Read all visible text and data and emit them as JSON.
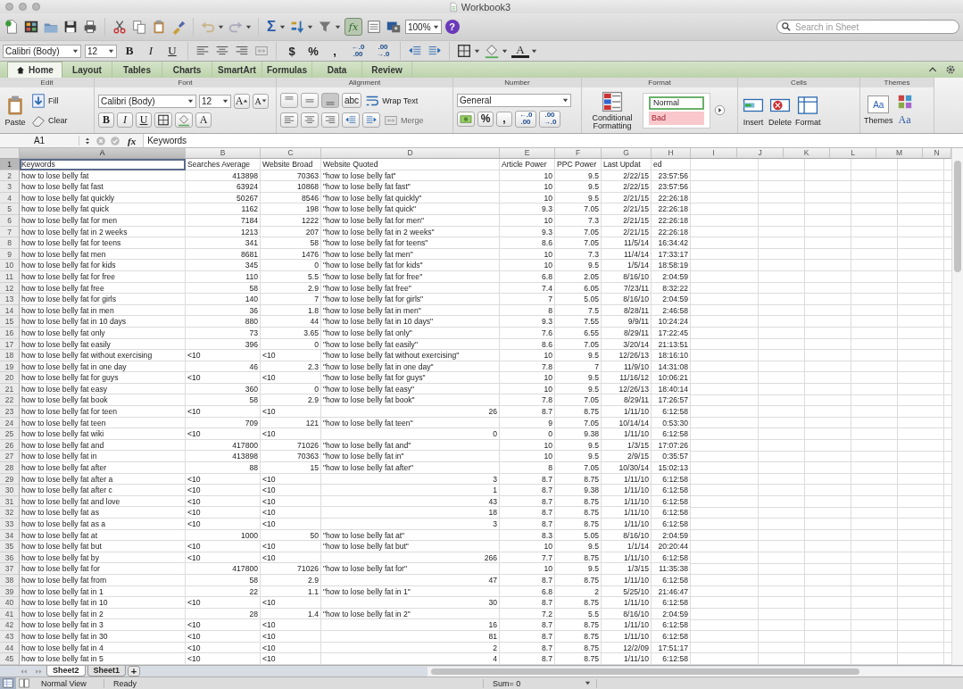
{
  "window": {
    "title": "Workbook3"
  },
  "toolbar": {
    "sum": "Σ",
    "fx": {
      "label": "fx",
      "selected": true
    },
    "zoom": "100%",
    "help": "?",
    "search": {
      "placeholder": "Search in Sheet"
    }
  },
  "format_bar": {
    "font": "Calibri (Body)",
    "size": "12",
    "styles": [
      "B",
      "I",
      "U"
    ],
    "number_buttons": [
      "$",
      "%",
      ","
    ],
    "decimals": [
      {
        "top": "←.0",
        "bottom": ".00"
      },
      {
        "top": ".00",
        "bottom": "→.0"
      }
    ],
    "font_color": "A"
  },
  "ribbon": {
    "tabs": [
      {
        "label": "Home",
        "selected": true
      },
      {
        "label": "Layout",
        "selected": false
      },
      {
        "label": "Tables",
        "selected": false
      },
      {
        "label": "Charts",
        "selected": false
      },
      {
        "label": "SmartArt",
        "selected": false
      },
      {
        "label": "Formulas",
        "selected": false
      },
      {
        "label": "Data",
        "selected": false
      },
      {
        "label": "Review",
        "selected": false
      }
    ],
    "edit": {
      "title": "Edit",
      "paste": "Paste",
      "fill": "Fill",
      "clear": "Clear"
    },
    "font": {
      "title": "Font",
      "family": "Calibri (Body)",
      "size": "12",
      "grow": "A",
      "shrink": "A",
      "styles": [
        "B",
        "I",
        "U"
      ],
      "color_button": "A"
    },
    "alignment": {
      "title": "Alignment",
      "orientation": "abc",
      "wrap": "Wrap Text",
      "merge": {
        "label": "Merge",
        "disabled": true
      }
    },
    "number": {
      "title": "Number",
      "format": "General",
      "buttons": [
        "%",
        ","
      ],
      "decimals": [
        {
          "top": "←.0",
          "bottom": ".00"
        },
        {
          "top": ".00",
          "bottom": "→.0"
        }
      ]
    },
    "format": {
      "title": "Format",
      "conditional": "Conditional Formatting",
      "styles": [
        {
          "label": "Normal",
          "kind": "normal"
        },
        {
          "label": "Bad",
          "kind": "bad"
        }
      ]
    },
    "cells": {
      "title": "Cells",
      "buttons": [
        "Insert",
        "Delete",
        "Format"
      ]
    },
    "themes": {
      "title": "Themes",
      "icon_text": "Aa",
      "label": "Themes",
      "fonts": "Aa"
    }
  },
  "formula_bar": {
    "cell": "A1",
    "fx": "fx",
    "value": "Keywords"
  },
  "sheet": {
    "columns": [
      {
        "label": "A",
        "selected": true
      },
      {
        "label": "B",
        "selected": false
      },
      {
        "label": "C",
        "selected": false
      },
      {
        "label": "D",
        "selected": false
      },
      {
        "label": "E",
        "selected": false
      },
      {
        "label": "F",
        "selected": false
      },
      {
        "label": "G",
        "selected": false
      },
      {
        "label": "H",
        "selected": false
      },
      {
        "label": "I",
        "selected": false
      },
      {
        "label": "J",
        "selected": false
      },
      {
        "label": "K",
        "selected": false
      },
      {
        "label": "L",
        "selected": false
      },
      {
        "label": "M",
        "selected": false
      },
      {
        "label": "N",
        "selected": false
      }
    ],
    "rows": [
      {
        "n": "1",
        "selected": true,
        "cells": [
          {
            "text": "Keywords",
            "kind": "text"
          },
          {
            "text": "Searches Average",
            "kind": "text"
          },
          {
            "text": "Website Broad",
            "kind": "text"
          },
          {
            "text": "Website Quoted",
            "kind": "text"
          },
          {
            "text": "Article Power",
            "kind": "text"
          },
          {
            "text": "PPC Power",
            "kind": "text"
          },
          {
            "text": "Last Updat",
            "kind": "text"
          },
          {
            "text": "ed",
            "kind": "text"
          }
        ]
      },
      {
        "n": "2",
        "selected": false,
        "cells": [
          {
            "text": "how to lose belly fat",
            "kind": "text"
          },
          {
            "text": "413898",
            "kind": "number"
          },
          {
            "text": "70363",
            "kind": "number"
          },
          {
            "text": "\"how to lose belly fat\"",
            "kind": "text"
          },
          {
            "text": "10",
            "kind": "number"
          },
          {
            "text": "9.5",
            "kind": "number"
          },
          {
            "text": "2/22/15",
            "kind": "number"
          },
          {
            "text": "23:57:56",
            "kind": "number"
          }
        ]
      },
      {
        "n": "3",
        "selected": false,
        "cells": [
          {
            "text": "how to lose belly fat fast",
            "kind": "text"
          },
          {
            "text": "63924",
            "kind": "number"
          },
          {
            "text": "10868",
            "kind": "number"
          },
          {
            "text": "\"how to lose belly fat fast\"",
            "kind": "text"
          },
          {
            "text": "10",
            "kind": "number"
          },
          {
            "text": "9.5",
            "kind": "number"
          },
          {
            "text": "2/22/15",
            "kind": "number"
          },
          {
            "text": "23:57:56",
            "kind": "number"
          }
        ]
      },
      {
        "n": "4",
        "selected": false,
        "cells": [
          {
            "text": "how to lose belly fat quickly",
            "kind": "text"
          },
          {
            "text": "50267",
            "kind": "number"
          },
          {
            "text": "8546",
            "kind": "number"
          },
          {
            "text": "\"how to lose belly fat quickly\"",
            "kind": "text"
          },
          {
            "text": "10",
            "kind": "number"
          },
          {
            "text": "9.5",
            "kind": "number"
          },
          {
            "text": "2/21/15",
            "kind": "number"
          },
          {
            "text": "22:26:18",
            "kind": "number"
          }
        ]
      },
      {
        "n": "5",
        "selected": false,
        "cells": [
          {
            "text": "how to lose belly fat quick",
            "kind": "text"
          },
          {
            "text": "1162",
            "kind": "number"
          },
          {
            "text": "198",
            "kind": "number"
          },
          {
            "text": "\"how to lose belly fat quick\"",
            "kind": "text"
          },
          {
            "text": "9.3",
            "kind": "number"
          },
          {
            "text": "7.05",
            "kind": "number"
          },
          {
            "text": "2/21/15",
            "kind": "number"
          },
          {
            "text": "22:26:18",
            "kind": "number"
          }
        ]
      },
      {
        "n": "6",
        "selected": false,
        "cells": [
          {
            "text": "how to lose belly fat for men",
            "kind": "text"
          },
          {
            "text": "7184",
            "kind": "number"
          },
          {
            "text": "1222",
            "kind": "number"
          },
          {
            "text": "\"how to lose belly fat for men\"",
            "kind": "text"
          },
          {
            "text": "10",
            "kind": "number"
          },
          {
            "text": "7.3",
            "kind": "number"
          },
          {
            "text": "2/21/15",
            "kind": "number"
          },
          {
            "text": "22:26:18",
            "kind": "number"
          }
        ]
      },
      {
        "n": "7",
        "selected": false,
        "cells": [
          {
            "text": "how to lose belly fat in 2 weeks",
            "kind": "text"
          },
          {
            "text": "1213",
            "kind": "number"
          },
          {
            "text": "207",
            "kind": "number"
          },
          {
            "text": "\"how to lose belly fat in 2 weeks\"",
            "kind": "text"
          },
          {
            "text": "9.3",
            "kind": "number"
          },
          {
            "text": "7.05",
            "kind": "number"
          },
          {
            "text": "2/21/15",
            "kind": "number"
          },
          {
            "text": "22:26:18",
            "kind": "number"
          }
        ]
      },
      {
        "n": "8",
        "selected": false,
        "cells": [
          {
            "text": "how to lose belly fat for teens",
            "kind": "text"
          },
          {
            "text": "341",
            "kind": "number"
          },
          {
            "text": "58",
            "kind": "number"
          },
          {
            "text": "\"how to lose belly fat for teens\"",
            "kind": "text"
          },
          {
            "text": "8.6",
            "kind": "number"
          },
          {
            "text": "7.05",
            "kind": "number"
          },
          {
            "text": "11/5/14",
            "kind": "number"
          },
          {
            "text": "16:34:42",
            "kind": "number"
          }
        ]
      },
      {
        "n": "9",
        "selected": false,
        "cells": [
          {
            "text": "how to lose belly fat men",
            "kind": "text"
          },
          {
            "text": "8681",
            "kind": "number"
          },
          {
            "text": "1476",
            "kind": "number"
          },
          {
            "text": "\"how to lose belly fat men\"",
            "kind": "text"
          },
          {
            "text": "10",
            "kind": "number"
          },
          {
            "text": "7.3",
            "kind": "number"
          },
          {
            "text": "11/4/14",
            "kind": "number"
          },
          {
            "text": "17:33:17",
            "kind": "number"
          }
        ]
      },
      {
        "n": "10",
        "selected": false,
        "cells": [
          {
            "text": "how to lose belly fat for kids",
            "kind": "text"
          },
          {
            "text": "345",
            "kind": "number"
          },
          {
            "text": "0",
            "kind": "number"
          },
          {
            "text": "\"how to lose belly fat for kids\"",
            "kind": "text"
          },
          {
            "text": "10",
            "kind": "number"
          },
          {
            "text": "9.5",
            "kind": "number"
          },
          {
            "text": "1/5/14",
            "kind": "number"
          },
          {
            "text": "18:58:19",
            "kind": "number"
          }
        ]
      },
      {
        "n": "11",
        "selected": false,
        "cells": [
          {
            "text": "how to lose belly fat for free",
            "kind": "text"
          },
          {
            "text": "110",
            "kind": "number"
          },
          {
            "text": "5.5",
            "kind": "number"
          },
          {
            "text": "\"how to lose belly fat for free\"",
            "kind": "text"
          },
          {
            "text": "6.8",
            "kind": "number"
          },
          {
            "text": "2.05",
            "kind": "number"
          },
          {
            "text": "8/16/10",
            "kind": "number"
          },
          {
            "text": "2:04:59",
            "kind": "number"
          }
        ]
      },
      {
        "n": "12",
        "selected": false,
        "cells": [
          {
            "text": "how to lose belly fat free",
            "kind": "text"
          },
          {
            "text": "58",
            "kind": "number"
          },
          {
            "text": "2.9",
            "kind": "number"
          },
          {
            "text": "\"how to lose belly fat free\"",
            "kind": "text"
          },
          {
            "text": "7.4",
            "kind": "number"
          },
          {
            "text": "6.05",
            "kind": "number"
          },
          {
            "text": "7/23/11",
            "kind": "number"
          },
          {
            "text": "8:32:22",
            "kind": "number"
          }
        ]
      },
      {
        "n": "13",
        "selected": false,
        "cells": [
          {
            "text": "how to lose belly fat for girls",
            "kind": "text"
          },
          {
            "text": "140",
            "kind": "number"
          },
          {
            "text": "7",
            "kind": "number"
          },
          {
            "text": "\"how to lose belly fat for girls\"",
            "kind": "text"
          },
          {
            "text": "7",
            "kind": "number"
          },
          {
            "text": "5.05",
            "kind": "number"
          },
          {
            "text": "8/16/10",
            "kind": "number"
          },
          {
            "text": "2:04:59",
            "kind": "number"
          }
        ]
      },
      {
        "n": "14",
        "selected": false,
        "cells": [
          {
            "text": "how to lose belly fat in men",
            "kind": "text"
          },
          {
            "text": "36",
            "kind": "number"
          },
          {
            "text": "1.8",
            "kind": "number"
          },
          {
            "text": "\"how to lose belly fat in men\"",
            "kind": "text"
          },
          {
            "text": "8",
            "kind": "number"
          },
          {
            "text": "7.5",
            "kind": "number"
          },
          {
            "text": "8/28/11",
            "kind": "number"
          },
          {
            "text": "2:46:58",
            "kind": "number"
          }
        ]
      },
      {
        "n": "15",
        "selected": false,
        "cells": [
          {
            "text": "how to lose belly fat in 10 days",
            "kind": "text"
          },
          {
            "text": "880",
            "kind": "number"
          },
          {
            "text": "44",
            "kind": "number"
          },
          {
            "text": "\"how to lose belly fat in 10 days\"",
            "kind": "text"
          },
          {
            "text": "9.3",
            "kind": "number"
          },
          {
            "text": "7.55",
            "kind": "number"
          },
          {
            "text": "9/9/11",
            "kind": "number"
          },
          {
            "text": "10:24:24",
            "kind": "number"
          }
        ]
      },
      {
        "n": "16",
        "selected": false,
        "cells": [
          {
            "text": "how to lose belly fat only",
            "kind": "text"
          },
          {
            "text": "73",
            "kind": "number"
          },
          {
            "text": "3.65",
            "kind": "number"
          },
          {
            "text": "\"how to lose belly fat only\"",
            "kind": "text"
          },
          {
            "text": "7.6",
            "kind": "number"
          },
          {
            "text": "6.55",
            "kind": "number"
          },
          {
            "text": "8/29/11",
            "kind": "number"
          },
          {
            "text": "17:22:45",
            "kind": "number"
          }
        ]
      },
      {
        "n": "17",
        "selected": false,
        "cells": [
          {
            "text": "how to lose belly fat easily",
            "kind": "text"
          },
          {
            "text": "396",
            "kind": "number"
          },
          {
            "text": "0",
            "kind": "number"
          },
          {
            "text": "\"how to lose belly fat easily\"",
            "kind": "text"
          },
          {
            "text": "8.6",
            "kind": "number"
          },
          {
            "text": "7.05",
            "kind": "number"
          },
          {
            "text": "3/20/14",
            "kind": "number"
          },
          {
            "text": "21:13:51",
            "kind": "number"
          }
        ]
      },
      {
        "n": "18",
        "selected": false,
        "cells": [
          {
            "text": "how to lose belly fat without exercising",
            "kind": "text"
          },
          {
            "text": "<10",
            "kind": "text"
          },
          {
            "text": "<10",
            "kind": "text"
          },
          {
            "text": "\"how to lose belly fat without exercising\"",
            "kind": "text"
          },
          {
            "text": "10",
            "kind": "number"
          },
          {
            "text": "9.5",
            "kind": "number"
          },
          {
            "text": "12/26/13",
            "kind": "number"
          },
          {
            "text": "18:16:10",
            "kind": "number"
          }
        ]
      },
      {
        "n": "19",
        "selected": false,
        "cells": [
          {
            "text": "how to lose belly fat in one day",
            "kind": "text"
          },
          {
            "text": "46",
            "kind": "number"
          },
          {
            "text": "2.3",
            "kind": "number"
          },
          {
            "text": "\"how to lose belly fat in one day\"",
            "kind": "text"
          },
          {
            "text": "7.8",
            "kind": "number"
          },
          {
            "text": "7",
            "kind": "number"
          },
          {
            "text": "11/9/10",
            "kind": "number"
          },
          {
            "text": "14:31:08",
            "kind": "number"
          }
        ]
      },
      {
        "n": "20",
        "selected": false,
        "cells": [
          {
            "text": "how to lose belly fat for guys",
            "kind": "text"
          },
          {
            "text": "<10",
            "kind": "text"
          },
          {
            "text": "<10",
            "kind": "text"
          },
          {
            "text": "\"how to lose belly fat for guys\"",
            "kind": "text"
          },
          {
            "text": "10",
            "kind": "number"
          },
          {
            "text": "9.5",
            "kind": "number"
          },
          {
            "text": "11/16/12",
            "kind": "number"
          },
          {
            "text": "10:06:21",
            "kind": "number"
          }
        ]
      },
      {
        "n": "21",
        "selected": false,
        "cells": [
          {
            "text": "how to lose belly fat easy",
            "kind": "text"
          },
          {
            "text": "360",
            "kind": "number"
          },
          {
            "text": "0",
            "kind": "number"
          },
          {
            "text": "\"how to lose belly fat easy\"",
            "kind": "text"
          },
          {
            "text": "10",
            "kind": "number"
          },
          {
            "text": "9.5",
            "kind": "number"
          },
          {
            "text": "12/26/13",
            "kind": "number"
          },
          {
            "text": "18:40:14",
            "kind": "number"
          }
        ]
      },
      {
        "n": "22",
        "selected": false,
        "cells": [
          {
            "text": "how to lose belly fat book",
            "kind": "text"
          },
          {
            "text": "58",
            "kind": "number"
          },
          {
            "text": "2.9",
            "kind": "number"
          },
          {
            "text": "\"how to lose belly fat book\"",
            "kind": "text"
          },
          {
            "text": "7.8",
            "kind": "number"
          },
          {
            "text": "7.05",
            "kind": "number"
          },
          {
            "text": "8/29/11",
            "kind": "number"
          },
          {
            "text": "17:26:57",
            "kind": "number"
          }
        ]
      },
      {
        "n": "23",
        "selected": false,
        "cells": [
          {
            "text": "how to lose belly fat for teen",
            "kind": "text"
          },
          {
            "text": "<10",
            "kind": "text"
          },
          {
            "text": "<10",
            "kind": "text"
          },
          {
            "text": "26",
            "kind": "number"
          },
          {
            "text": "8.7",
            "kind": "number"
          },
          {
            "text": "8.75",
            "kind": "number"
          },
          {
            "text": "1/11/10",
            "kind": "number"
          },
          {
            "text": "6:12:58",
            "kind": "number"
          }
        ]
      },
      {
        "n": "24",
        "selected": false,
        "cells": [
          {
            "text": "how to lose belly fat teen",
            "kind": "text"
          },
          {
            "text": "709",
            "kind": "number"
          },
          {
            "text": "121",
            "kind": "number"
          },
          {
            "text": "\"how to lose belly fat teen\"",
            "kind": "text"
          },
          {
            "text": "9",
            "kind": "number"
          },
          {
            "text": "7.05",
            "kind": "number"
          },
          {
            "text": "10/14/14",
            "kind": "number"
          },
          {
            "text": "0:53:30",
            "kind": "number"
          }
        ]
      },
      {
        "n": "25",
        "selected": false,
        "cells": [
          {
            "text": "how to lose belly fat wiki",
            "kind": "text"
          },
          {
            "text": "<10",
            "kind": "text"
          },
          {
            "text": "<10",
            "kind": "text"
          },
          {
            "text": "0",
            "kind": "number"
          },
          {
            "text": "0",
            "kind": "number"
          },
          {
            "text": "9.38",
            "kind": "number"
          },
          {
            "text": "1/11/10",
            "kind": "number"
          },
          {
            "text": "6:12:58",
            "kind": "number"
          }
        ]
      },
      {
        "n": "26",
        "selected": false,
        "cells": [
          {
            "text": "how to lose belly fat and",
            "kind": "text"
          },
          {
            "text": "417800",
            "kind": "number"
          },
          {
            "text": "71026",
            "kind": "number"
          },
          {
            "text": "\"how to lose belly fat and\"",
            "kind": "text"
          },
          {
            "text": "10",
            "kind": "number"
          },
          {
            "text": "9.5",
            "kind": "number"
          },
          {
            "text": "1/3/15",
            "kind": "number"
          },
          {
            "text": "17:07:26",
            "kind": "number"
          }
        ]
      },
      {
        "n": "27",
        "selected": false,
        "cells": [
          {
            "text": "how to lose belly fat in",
            "kind": "text"
          },
          {
            "text": "413898",
            "kind": "number"
          },
          {
            "text": "70363",
            "kind": "number"
          },
          {
            "text": "\"how to lose belly fat in\"",
            "kind": "text"
          },
          {
            "text": "10",
            "kind": "number"
          },
          {
            "text": "9.5",
            "kind": "number"
          },
          {
            "text": "2/9/15",
            "kind": "number"
          },
          {
            "text": "0:35:57",
            "kind": "number"
          }
        ]
      },
      {
        "n": "28",
        "selected": false,
        "cells": [
          {
            "text": "how to lose belly fat after",
            "kind": "text"
          },
          {
            "text": "88",
            "kind": "number"
          },
          {
            "text": "15",
            "kind": "number"
          },
          {
            "text": "\"how to lose belly fat after\"",
            "kind": "text"
          },
          {
            "text": "8",
            "kind": "number"
          },
          {
            "text": "7.05",
            "kind": "number"
          },
          {
            "text": "10/30/14",
            "kind": "number"
          },
          {
            "text": "15:02:13",
            "kind": "number"
          }
        ]
      },
      {
        "n": "29",
        "selected": false,
        "cells": [
          {
            "text": "how to lose belly fat after a",
            "kind": "text"
          },
          {
            "text": "<10",
            "kind": "text"
          },
          {
            "text": "<10",
            "kind": "text"
          },
          {
            "text": "3",
            "kind": "number"
          },
          {
            "text": "8.7",
            "kind": "number"
          },
          {
            "text": "8.75",
            "kind": "number"
          },
          {
            "text": "1/11/10",
            "kind": "number"
          },
          {
            "text": "6:12:58",
            "kind": "number"
          }
        ]
      },
      {
        "n": "30",
        "selected": false,
        "cells": [
          {
            "text": "how to lose belly fat after c",
            "kind": "text"
          },
          {
            "text": "<10",
            "kind": "text"
          },
          {
            "text": "<10",
            "kind": "text"
          },
          {
            "text": "1",
            "kind": "number"
          },
          {
            "text": "8.7",
            "kind": "number"
          },
          {
            "text": "9.38",
            "kind": "number"
          },
          {
            "text": "1/11/10",
            "kind": "number"
          },
          {
            "text": "6:12:58",
            "kind": "number"
          }
        ]
      },
      {
        "n": "31",
        "selected": false,
        "cells": [
          {
            "text": "how to lose belly fat and love",
            "kind": "text"
          },
          {
            "text": "<10",
            "kind": "text"
          },
          {
            "text": "<10",
            "kind": "text"
          },
          {
            "text": "43",
            "kind": "number"
          },
          {
            "text": "8.7",
            "kind": "number"
          },
          {
            "text": "8.75",
            "kind": "number"
          },
          {
            "text": "1/11/10",
            "kind": "number"
          },
          {
            "text": "6:12:58",
            "kind": "number"
          }
        ]
      },
      {
        "n": "32",
        "selected": false,
        "cells": [
          {
            "text": "how to lose belly fat as",
            "kind": "text"
          },
          {
            "text": "<10",
            "kind": "text"
          },
          {
            "text": "<10",
            "kind": "text"
          },
          {
            "text": "18",
            "kind": "number"
          },
          {
            "text": "8.7",
            "kind": "number"
          },
          {
            "text": "8.75",
            "kind": "number"
          },
          {
            "text": "1/11/10",
            "kind": "number"
          },
          {
            "text": "6:12:58",
            "kind": "number"
          }
        ]
      },
      {
        "n": "33",
        "selected": false,
        "cells": [
          {
            "text": "how to lose belly fat as a",
            "kind": "text"
          },
          {
            "text": "<10",
            "kind": "text"
          },
          {
            "text": "<10",
            "kind": "text"
          },
          {
            "text": "3",
            "kind": "number"
          },
          {
            "text": "8.7",
            "kind": "number"
          },
          {
            "text": "8.75",
            "kind": "number"
          },
          {
            "text": "1/11/10",
            "kind": "number"
          },
          {
            "text": "6:12:58",
            "kind": "number"
          }
        ]
      },
      {
        "n": "34",
        "selected": false,
        "cells": [
          {
            "text": "how to lose belly fat at",
            "kind": "text"
          },
          {
            "text": "1000",
            "kind": "number"
          },
          {
            "text": "50",
            "kind": "number"
          },
          {
            "text": "\"how to lose belly fat at\"",
            "kind": "text"
          },
          {
            "text": "8.3",
            "kind": "number"
          },
          {
            "text": "5.05",
            "kind": "number"
          },
          {
            "text": "8/16/10",
            "kind": "number"
          },
          {
            "text": "2:04:59",
            "kind": "number"
          }
        ]
      },
      {
        "n": "35",
        "selected": false,
        "cells": [
          {
            "text": "how to lose belly fat but",
            "kind": "text"
          },
          {
            "text": "<10",
            "kind": "text"
          },
          {
            "text": "<10",
            "kind": "text"
          },
          {
            "text": "\"how to lose belly fat but\"",
            "kind": "text"
          },
          {
            "text": "10",
            "kind": "number"
          },
          {
            "text": "9.5",
            "kind": "number"
          },
          {
            "text": "1/1/14",
            "kind": "number"
          },
          {
            "text": "20:20:44",
            "kind": "number"
          }
        ]
      },
      {
        "n": "36",
        "selected": false,
        "cells": [
          {
            "text": "how to lose belly fat by",
            "kind": "text"
          },
          {
            "text": "<10",
            "kind": "text"
          },
          {
            "text": "<10",
            "kind": "text"
          },
          {
            "text": "266",
            "kind": "number"
          },
          {
            "text": "7.7",
            "kind": "number"
          },
          {
            "text": "8.75",
            "kind": "number"
          },
          {
            "text": "1/11/10",
            "kind": "number"
          },
          {
            "text": "6:12:58",
            "kind": "number"
          }
        ]
      },
      {
        "n": "37",
        "selected": false,
        "cells": [
          {
            "text": "how to lose belly fat for",
            "kind": "text"
          },
          {
            "text": "417800",
            "kind": "number"
          },
          {
            "text": "71026",
            "kind": "number"
          },
          {
            "text": "\"how to lose belly fat for\"",
            "kind": "text"
          },
          {
            "text": "10",
            "kind": "number"
          },
          {
            "text": "9.5",
            "kind": "number"
          },
          {
            "text": "1/3/15",
            "kind": "number"
          },
          {
            "text": "11:35:38",
            "kind": "number"
          }
        ]
      },
      {
        "n": "38",
        "selected": false,
        "cells": [
          {
            "text": "how to lose belly fat from",
            "kind": "text"
          },
          {
            "text": "58",
            "kind": "number"
          },
          {
            "text": "2.9",
            "kind": "number"
          },
          {
            "text": "47",
            "kind": "number"
          },
          {
            "text": "8.7",
            "kind": "number"
          },
          {
            "text": "8.75",
            "kind": "number"
          },
          {
            "text": "1/11/10",
            "kind": "number"
          },
          {
            "text": "6:12:58",
            "kind": "number"
          }
        ]
      },
      {
        "n": "39",
        "selected": false,
        "cells": [
          {
            "text": "how to lose belly fat in 1",
            "kind": "text"
          },
          {
            "text": "22",
            "kind": "number"
          },
          {
            "text": "1.1",
            "kind": "number"
          },
          {
            "text": "\"how to lose belly fat in 1\"",
            "kind": "text"
          },
          {
            "text": "6.8",
            "kind": "number"
          },
          {
            "text": "2",
            "kind": "number"
          },
          {
            "text": "5/25/10",
            "kind": "number"
          },
          {
            "text": "21:46:47",
            "kind": "number"
          }
        ]
      },
      {
        "n": "40",
        "selected": false,
        "cells": [
          {
            "text": "how to lose belly fat in 10",
            "kind": "text"
          },
          {
            "text": "<10",
            "kind": "text"
          },
          {
            "text": "<10",
            "kind": "text"
          },
          {
            "text": "30",
            "kind": "number"
          },
          {
            "text": "8.7",
            "kind": "number"
          },
          {
            "text": "8.75",
            "kind": "number"
          },
          {
            "text": "1/11/10",
            "kind": "number"
          },
          {
            "text": "6:12:58",
            "kind": "number"
          }
        ]
      },
      {
        "n": "41",
        "selected": false,
        "cells": [
          {
            "text": "how to lose belly fat in 2",
            "kind": "text"
          },
          {
            "text": "28",
            "kind": "number"
          },
          {
            "text": "1.4",
            "kind": "number"
          },
          {
            "text": "\"how to lose belly fat in 2\"",
            "kind": "text"
          },
          {
            "text": "7.2",
            "kind": "number"
          },
          {
            "text": "5.5",
            "kind": "number"
          },
          {
            "text": "8/16/10",
            "kind": "number"
          },
          {
            "text": "2:04:59",
            "kind": "number"
          }
        ]
      },
      {
        "n": "42",
        "selected": false,
        "cells": [
          {
            "text": "how to lose belly fat in 3",
            "kind": "text"
          },
          {
            "text": "<10",
            "kind": "text"
          },
          {
            "text": "<10",
            "kind": "text"
          },
          {
            "text": "16",
            "kind": "number"
          },
          {
            "text": "8.7",
            "kind": "number"
          },
          {
            "text": "8.75",
            "kind": "number"
          },
          {
            "text": "1/11/10",
            "kind": "number"
          },
          {
            "text": "6:12:58",
            "kind": "number"
          }
        ]
      },
      {
        "n": "43",
        "selected": false,
        "cells": [
          {
            "text": "how to lose belly fat in 30",
            "kind": "text"
          },
          {
            "text": "<10",
            "kind": "text"
          },
          {
            "text": "<10",
            "kind": "text"
          },
          {
            "text": "81",
            "kind": "number"
          },
          {
            "text": "8.7",
            "kind": "number"
          },
          {
            "text": "8.75",
            "kind": "number"
          },
          {
            "text": "1/11/10",
            "kind": "number"
          },
          {
            "text": "6:12:58",
            "kind": "number"
          }
        ]
      },
      {
        "n": "44",
        "selected": false,
        "cells": [
          {
            "text": "how to lose belly fat in 4",
            "kind": "text"
          },
          {
            "text": "<10",
            "kind": "text"
          },
          {
            "text": "<10",
            "kind": "text"
          },
          {
            "text": "2",
            "kind": "number"
          },
          {
            "text": "8.7",
            "kind": "number"
          },
          {
            "text": "8.75",
            "kind": "number"
          },
          {
            "text": "12/2/09",
            "kind": "number"
          },
          {
            "text": "17:51:17",
            "kind": "number"
          }
        ]
      },
      {
        "n": "45",
        "selected": false,
        "cells": [
          {
            "text": "how to lose belly fat in 5",
            "kind": "text"
          },
          {
            "text": "<10",
            "kind": "text"
          },
          {
            "text": "<10",
            "kind": "text"
          },
          {
            "text": "4",
            "kind": "number"
          },
          {
            "text": "8.7",
            "kind": "number"
          },
          {
            "text": "8.75",
            "kind": "number"
          },
          {
            "text": "1/11/10",
            "kind": "number"
          },
          {
            "text": "6:12:58",
            "kind": "number"
          }
        ]
      }
    ]
  },
  "sheet_tabs": [
    {
      "label": "Sheet2",
      "selected": true
    },
    {
      "label": "Sheet1",
      "selected": false
    }
  ],
  "add_sheet": "+",
  "status_bar": {
    "view": "Normal View",
    "state": "Ready",
    "sum": "Sum= 0"
  }
}
